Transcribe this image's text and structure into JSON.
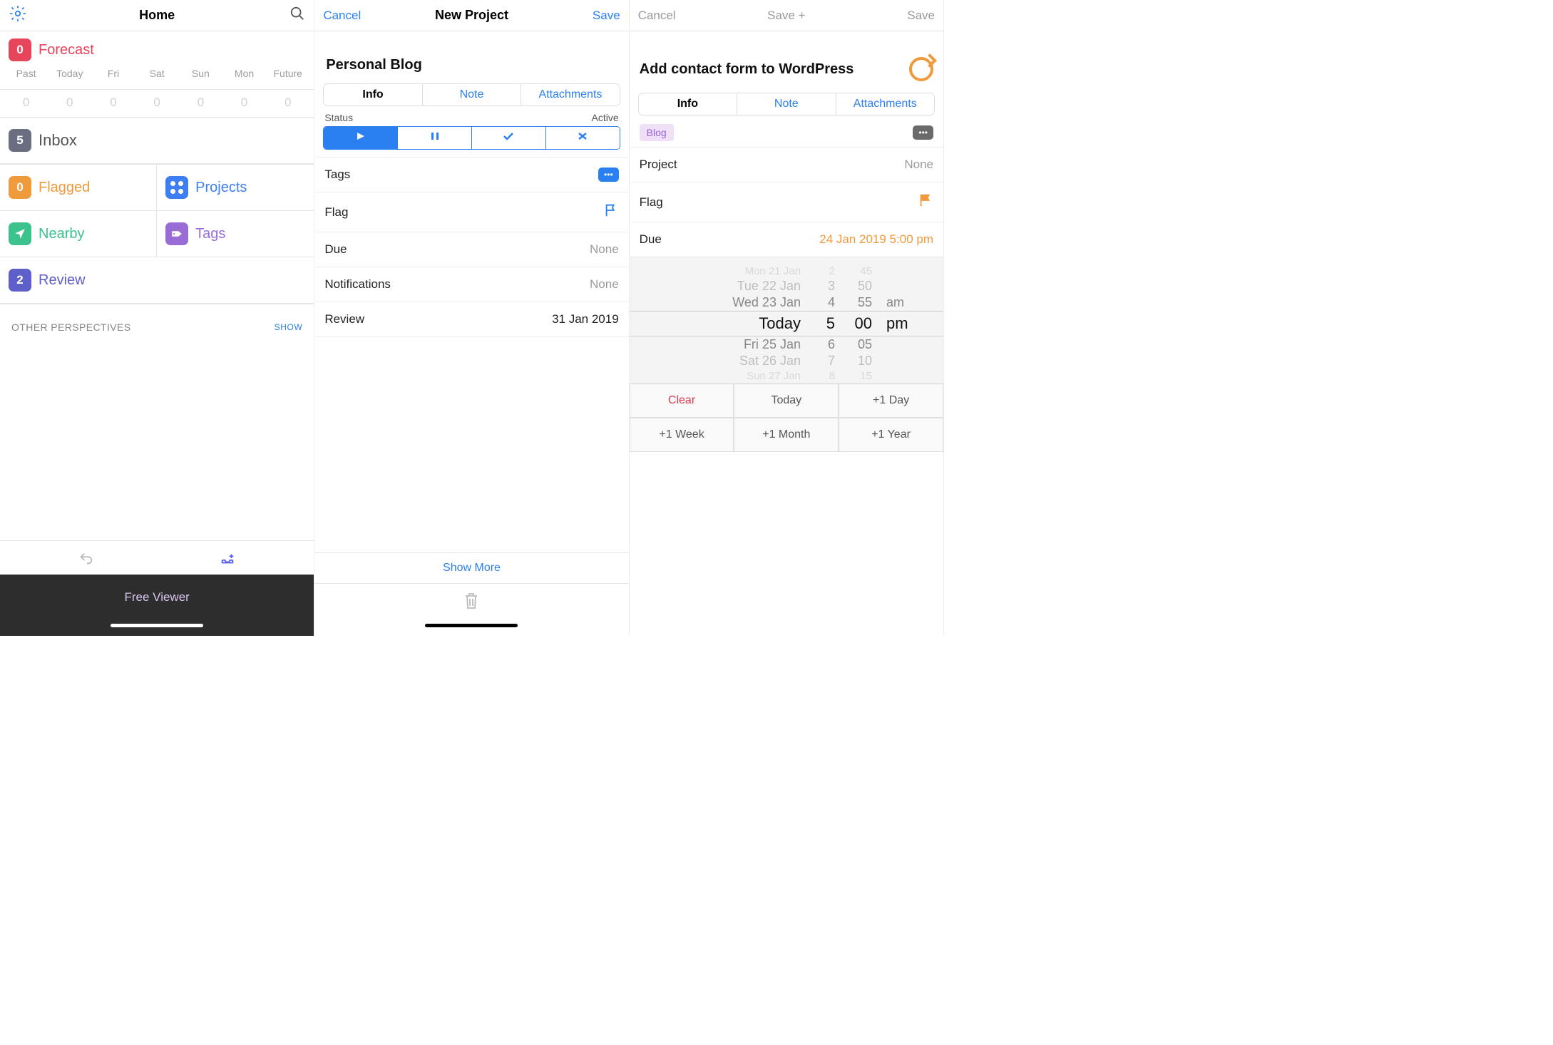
{
  "panel1": {
    "title": "Home",
    "forecast": {
      "label": "Forecast",
      "badge": "0",
      "days": [
        "Past",
        "Today",
        "Fri",
        "Sat",
        "Sun",
        "Mon",
        "Future"
      ],
      "counts": [
        "0",
        "0",
        "0",
        "0",
        "0",
        "0",
        "0"
      ]
    },
    "inbox": {
      "badge": "5",
      "label": "Inbox"
    },
    "items": {
      "flagged": {
        "badge": "0",
        "label": "Flagged"
      },
      "projects": {
        "label": "Projects"
      },
      "nearby": {
        "label": "Nearby"
      },
      "tags": {
        "label": "Tags"
      },
      "review": {
        "badge": "2",
        "label": "Review"
      }
    },
    "other_label": "OTHER PERSPECTIVES",
    "show_label": "SHOW",
    "viewer_label": "Free Viewer"
  },
  "panel2": {
    "cancel": "Cancel",
    "title": "New Project",
    "save": "Save",
    "project_name": "Personal Blog",
    "tabs": {
      "info": "Info",
      "note": "Note",
      "attachments": "Attachments"
    },
    "status_label": "Status",
    "status_value": "Active",
    "rows": {
      "tags_label": "Tags",
      "flag_label": "Flag",
      "due_label": "Due",
      "due_value": "None",
      "notif_label": "Notifications",
      "notif_value": "None",
      "review_label": "Review",
      "review_value": "31 Jan 2019"
    },
    "show_more": "Show More"
  },
  "panel3": {
    "cancel": "Cancel",
    "saveplus": "Save +",
    "save": "Save",
    "task_title": "Add contact form to WordPress",
    "tabs": {
      "info": "Info",
      "note": "Note",
      "attachments": "Attachments"
    },
    "tag_pill": "Blog",
    "rows": {
      "project_label": "Project",
      "project_value": "None",
      "flag_label": "Flag",
      "due_label": "Due",
      "due_value": "24 Jan 2019  5:00 pm"
    },
    "picker": [
      {
        "d": "Mon 21 Jan",
        "h": "2",
        "m": "45",
        "p": "",
        "cls": "fade2"
      },
      {
        "d": "Tue 22 Jan",
        "h": "3",
        "m": "50",
        "p": "",
        "cls": "fade"
      },
      {
        "d": "Wed 23 Jan",
        "h": "4",
        "m": "55",
        "p": "am",
        "cls": ""
      },
      {
        "d": "Today",
        "h": "5",
        "m": "00",
        "p": "pm",
        "cls": "sel"
      },
      {
        "d": "Fri 25 Jan",
        "h": "6",
        "m": "05",
        "p": "",
        "cls": ""
      },
      {
        "d": "Sat 26 Jan",
        "h": "7",
        "m": "10",
        "p": "",
        "cls": "fade"
      },
      {
        "d": "Sun 27 Jan",
        "h": "8",
        "m": "15",
        "p": "",
        "cls": "fade2"
      }
    ],
    "quick": {
      "clear": "Clear",
      "today": "Today",
      "d1": "+1 Day",
      "w1": "+1 Week",
      "m1": "+1 Month",
      "y1": "+1 Year"
    }
  }
}
